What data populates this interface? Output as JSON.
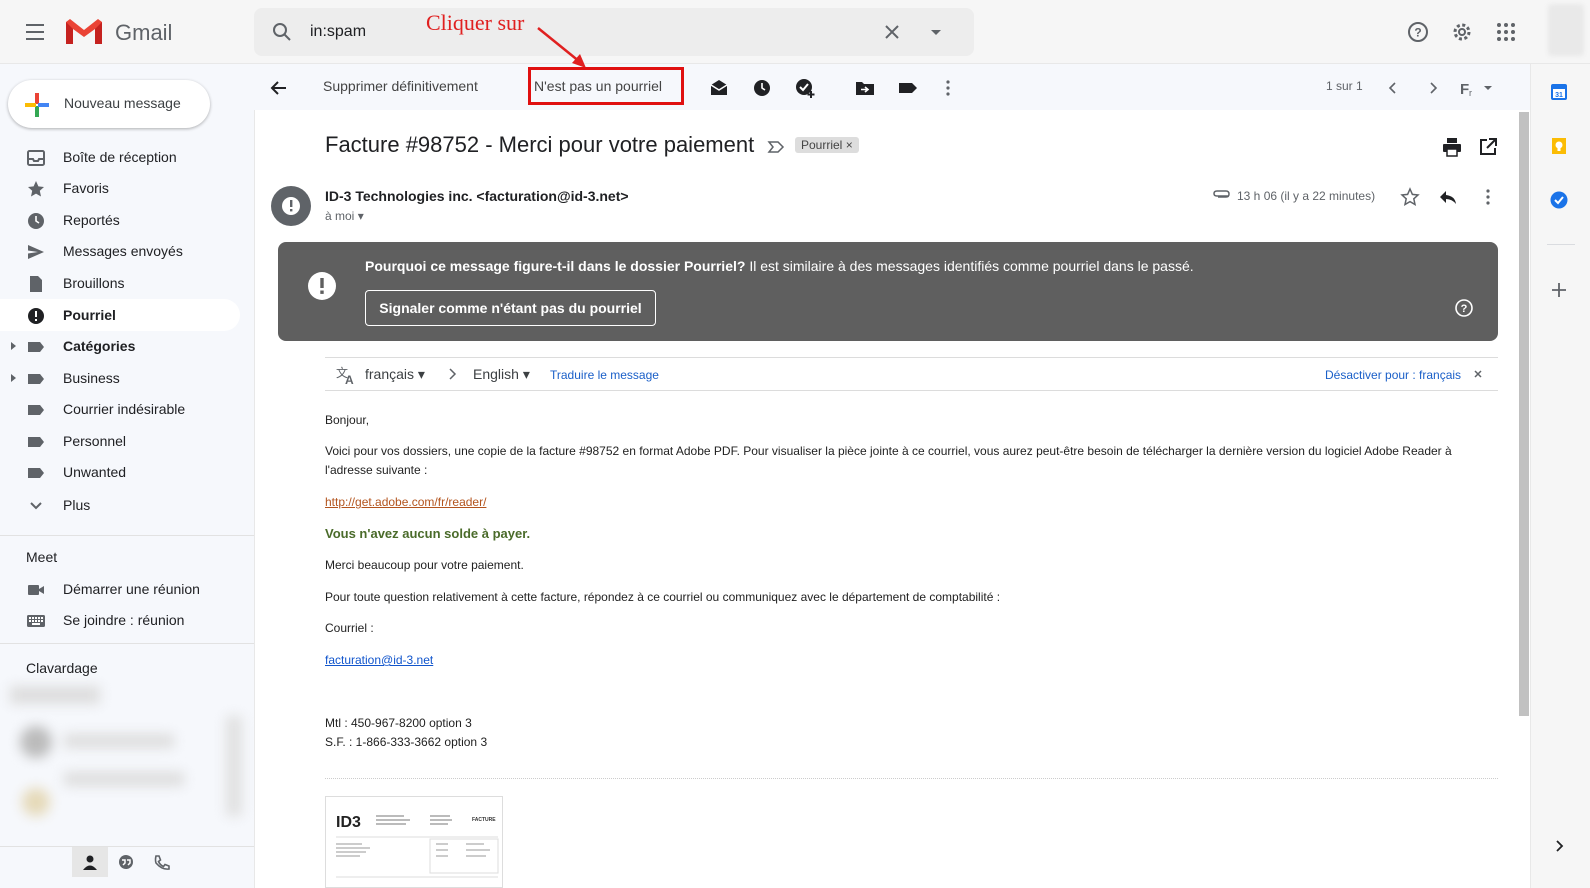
{
  "header": {
    "app_name": "Gmail",
    "search_value": "in:spam",
    "annotation": "Cliquer sur"
  },
  "sidebar": {
    "compose_label": "Nouveau message",
    "items": [
      {
        "label": "Boîte de réception"
      },
      {
        "label": "Favoris"
      },
      {
        "label": "Reportés"
      },
      {
        "label": "Messages envoyés"
      },
      {
        "label": "Brouillons"
      },
      {
        "label": "Pourriel"
      },
      {
        "label": "Catégories"
      },
      {
        "label": "Business"
      },
      {
        "label": "Courrier indésirable"
      },
      {
        "label": "Personnel"
      },
      {
        "label": "Unwanted"
      },
      {
        "label": "Plus"
      }
    ],
    "meet_title": "Meet",
    "meet_items": [
      "Démarrer une réunion",
      "Se joindre : réunion"
    ],
    "chat_title": "Clavardage"
  },
  "toolbar": {
    "delete_forever": "Supprimer définitivement",
    "not_spam": "N'est pas un pourriel",
    "pager": "1 sur 1"
  },
  "message": {
    "subject": "Facture #98752 - Merci pour votre paiement",
    "label": "Pourriel",
    "sender": "ID-3 Technologies inc. <facturation@id-3.net>",
    "to": "à moi",
    "time": "13 h 06 (il y a 22 minutes)",
    "warning_bold": "Pourquoi ce message figure-t-il dans le dossier Pourriel?",
    "warning_text": " Il est similaire à des messages identifiés comme pourriel dans le passé.",
    "warning_button": "Signaler comme n'étant pas du pourriel",
    "translate": {
      "from": "français",
      "to": "English",
      "action": "Traduire le message",
      "disable": "Désactiver pour : français"
    },
    "body": {
      "greeting": "Bonjour,",
      "p1": "Voici pour vos dossiers, une copie de la facture #98752 en format Adobe PDF.  Pour visualiser la pièce jointe à ce courriel, vous aurez peut-être besoin de télécharger la dernière version du logiciel Adobe Reader à l'adresse suivante :",
      "link": "http://get.adobe.com/fr/reader/",
      "balance": "Vous n'avez aucun solde à payer.",
      "thanks": "Merci beaucoup pour votre paiement.",
      "question": "Pour toute question relativement à cette facture, répondez à ce courriel ou communiquez avec le département de comptabilité :",
      "email_label": "Courriel :",
      "email": "facturation@id-3.net",
      "phone1": "Mtl :  450-967-8200 option 3",
      "phone2": "S.F. : 1-866-333-3662 option 3"
    },
    "attachment": {
      "logo": "ID3",
      "title": "FACTURE"
    }
  }
}
